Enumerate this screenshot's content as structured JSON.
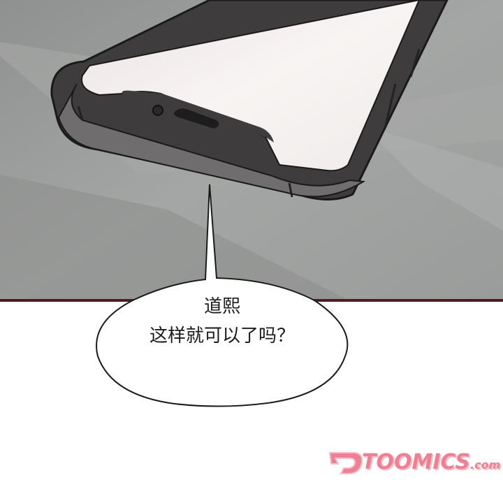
{
  "speech_bubble": {
    "line1": "道熙",
    "line2": "这样就可以了吗？"
  },
  "watermark": {
    "brand": "TOOMICS",
    "suffix": ".com",
    "color": "#ef7f93"
  },
  "colors": {
    "background": "#9c9e9d",
    "panel_border": "#4a1f22",
    "phone_frame": "#4b4b4b",
    "phone_screen": "#f3eeee"
  }
}
